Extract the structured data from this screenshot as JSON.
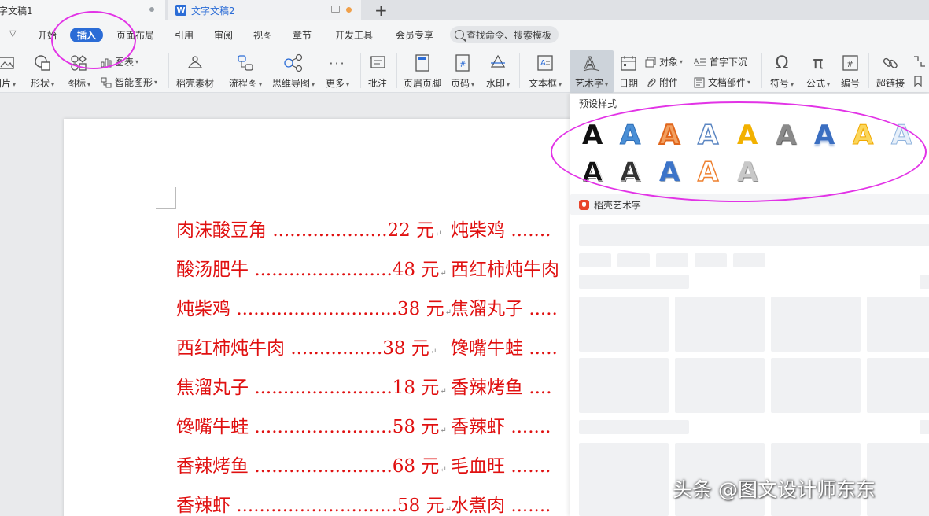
{
  "tabs": [
    {
      "label": "字文稿1"
    },
    {
      "label": "文字文稿2",
      "icon": "w-logo"
    }
  ],
  "menu": {
    "items": [
      "开始",
      "插入",
      "页面布局",
      "引用",
      "审阅",
      "视图",
      "章节",
      "开发工具",
      "会员专享"
    ],
    "active": "插入",
    "search_placeholder": "查找命令、搜索模板"
  },
  "ribbon": {
    "picture": "图片",
    "shape": "形状",
    "icon": "图标",
    "chart": "图表",
    "smartart": "智能图形",
    "daoke_material": "稻壳素材",
    "flowchart": "流程图",
    "mindmap": "思维导图",
    "more": "更多",
    "comment": "批注",
    "header_footer": "页眉页脚",
    "page_number": "页码",
    "watermark": "水印",
    "textbox": "文本框",
    "wordart": "艺术字",
    "date": "日期",
    "object": "对象",
    "attachment": "附件",
    "dropcap": "首字下沉",
    "doc_parts": "文档部件",
    "symbol": "符号",
    "formula": "公式",
    "numbering": "编号",
    "hyperlink": "超链接"
  },
  "document": {
    "left_menu": [
      {
        "name": "肉沫酸豆角",
        "dots": "....................",
        "price": "22 元"
      },
      {
        "name": "酸汤肥牛",
        "dots": "........................",
        "price": "48 元"
      },
      {
        "name": "炖柴鸡",
        "dots": "............................",
        "price": "38 元"
      },
      {
        "name": "西红柿炖牛肉",
        "dots": "................",
        "price": "38 元"
      },
      {
        "name": "焦溜丸子",
        "dots": "........................",
        "price": "18 元"
      },
      {
        "name": "馋嘴牛蛙",
        "dots": "........................",
        "price": "58 元"
      },
      {
        "name": "香辣烤鱼",
        "dots": "........................",
        "price": "68 元"
      },
      {
        "name": "香辣虾",
        "dots": "............................",
        "price": "58 元"
      }
    ],
    "right_menu": [
      {
        "name": "炖柴鸡",
        "dots": "......."
      },
      {
        "name": "西红柿炖牛肉",
        "dots": ""
      },
      {
        "name": "焦溜丸子",
        "dots": "....."
      },
      {
        "name": "馋嘴牛蛙",
        "dots": "....."
      },
      {
        "name": "香辣烤鱼",
        "dots": "...."
      },
      {
        "name": "香辣虾",
        "dots": "......."
      },
      {
        "name": "毛血旺",
        "dots": "......."
      },
      {
        "name": "水煮肉",
        "dots": "......."
      }
    ],
    "return_mark": "↵"
  },
  "panel": {
    "preset_title": "预设样式",
    "wordart_letter": "A",
    "daoke_title": "稻壳艺术字"
  },
  "watermark": "头条 @图文设计师东东",
  "colors": {
    "accent": "#2b6cd6",
    "menu_text": "#e01010",
    "highlight_ring": "#e233e6"
  }
}
